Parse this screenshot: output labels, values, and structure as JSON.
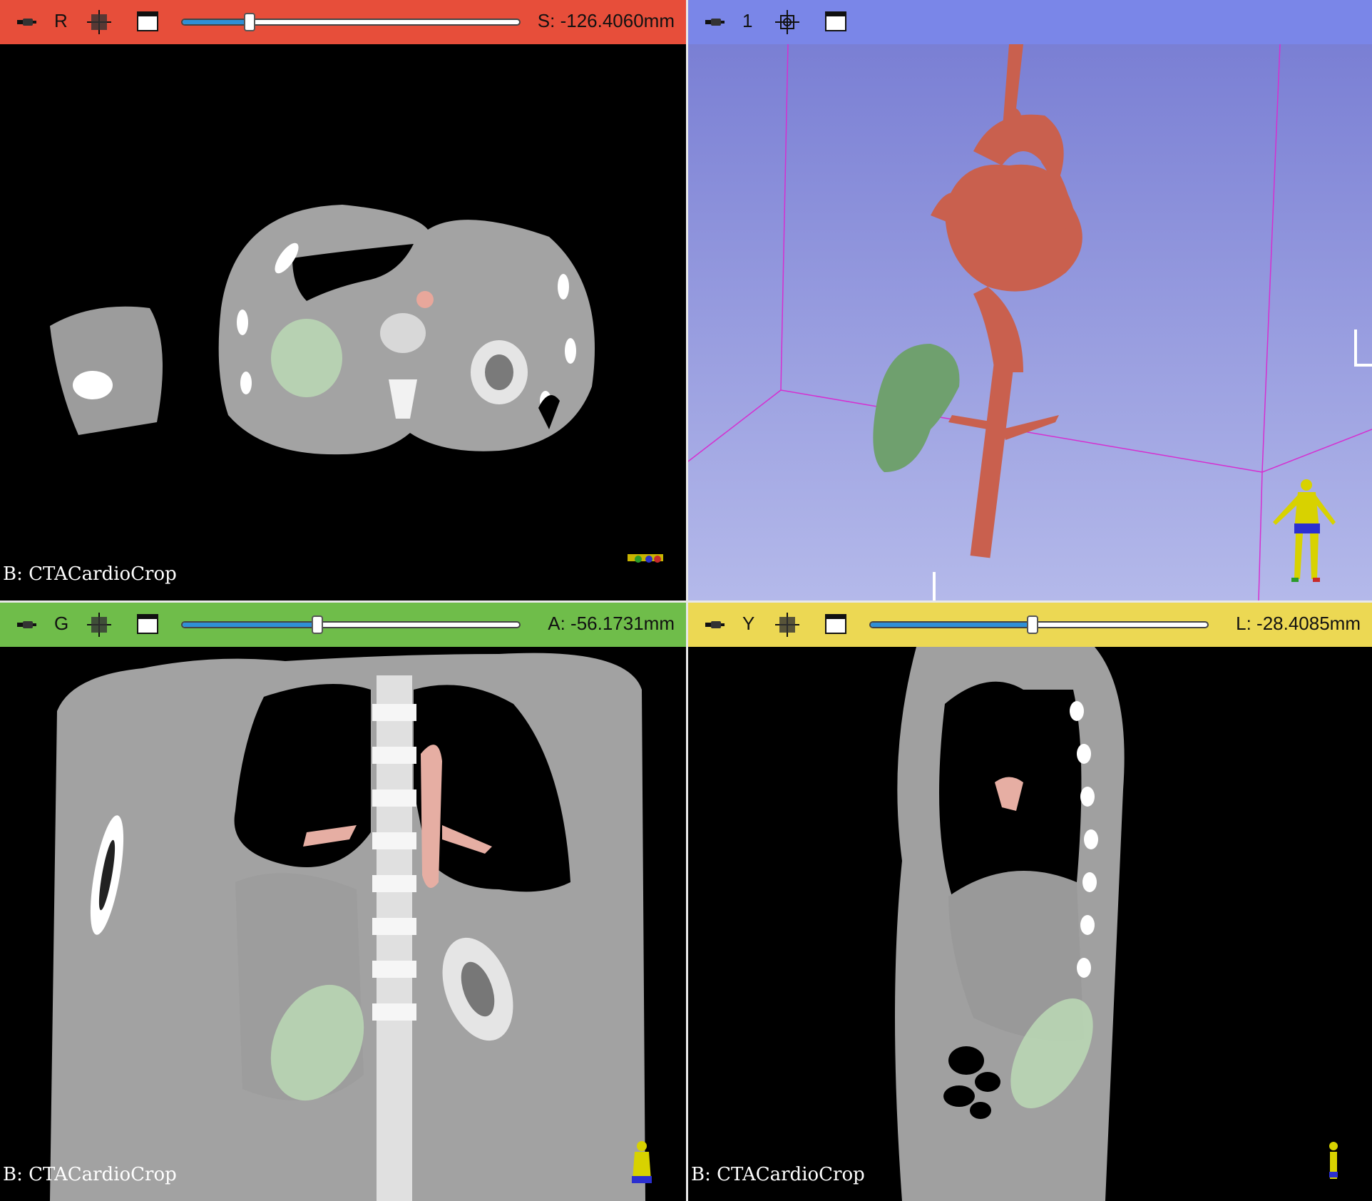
{
  "views": {
    "red": {
      "letter": "R",
      "coord": "S: -126.4060mm",
      "slider": 0.2,
      "volume": "B: CTACardioCrop"
    },
    "three_d": {
      "letter": "1"
    },
    "green": {
      "letter": "G",
      "coord": "A: -56.1731mm",
      "slider": 0.4,
      "volume": "B: CTACardioCrop"
    },
    "yellow": {
      "letter": "Y",
      "coord": "L: -28.4085mm",
      "slider": 0.48,
      "volume": "B: CTACardioCrop"
    }
  },
  "colors": {
    "red_bar": "#e74e3a",
    "three_d_bar": "#7a86e8",
    "green_bar": "#6fbd4a",
    "yellow_bar": "#ecd853",
    "vessel": "#c9604e",
    "kidney": "#6fa06e",
    "slider_fill": "#2f8fd6"
  },
  "icons": [
    "pin-icon",
    "slice-grid-icon",
    "view-grid-icon",
    "window-icon",
    "orientation-marker-icon"
  ]
}
